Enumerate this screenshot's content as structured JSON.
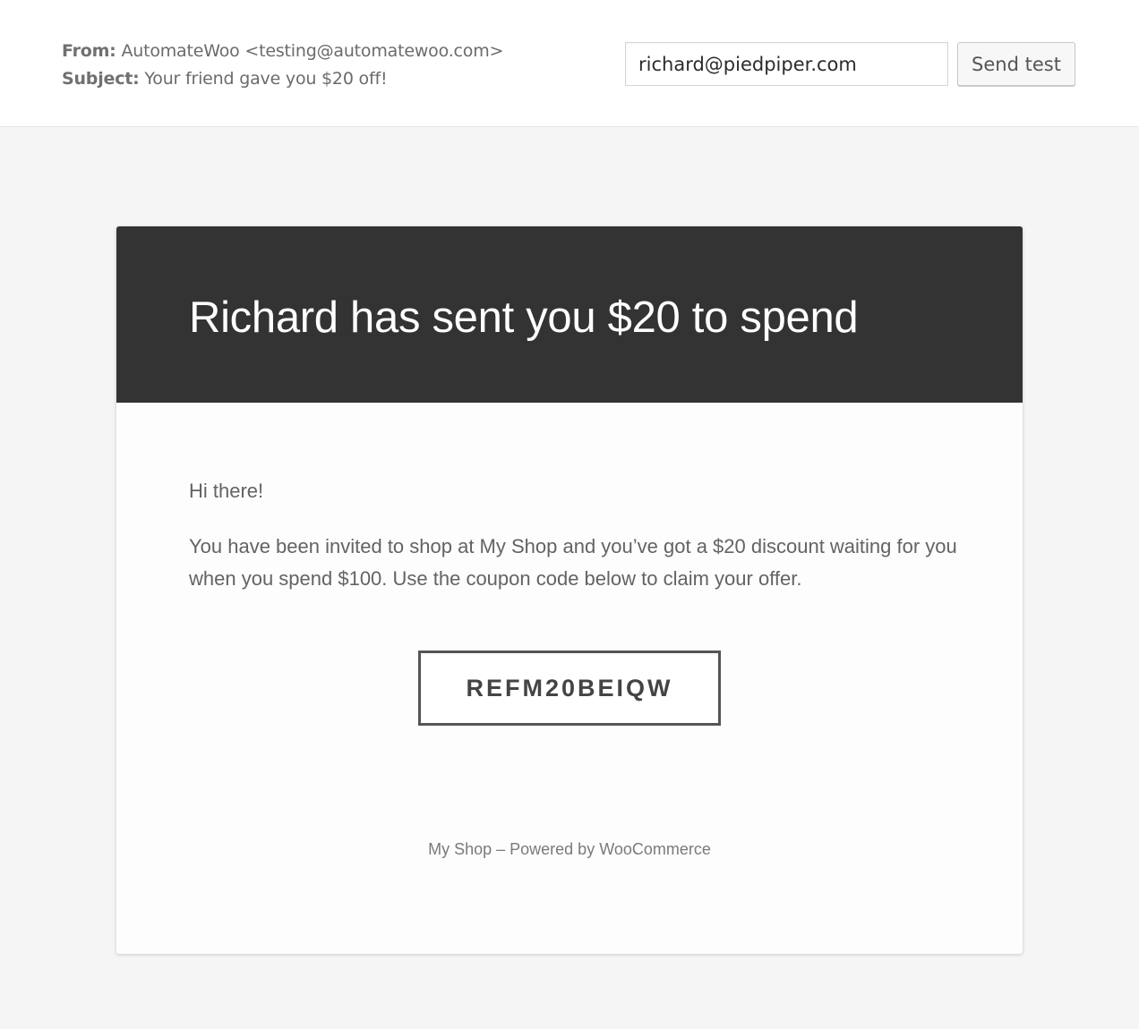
{
  "header": {
    "from_label": "From:",
    "from_value": "AutomateWoo <testing@automatewoo.com>",
    "subject_label": "Subject:",
    "subject_value": "Your friend gave you $20 off!"
  },
  "send_test": {
    "email_value": "richard@piedpiper.com",
    "button_label": "Send test"
  },
  "email": {
    "title": "Richard has sent you $20 to spend",
    "greeting": "Hi there!",
    "body": "You have been invited to shop at My Shop and you’ve got a $20 discount waiting for you when you spend $100. Use the coupon code below to claim your offer.",
    "coupon_code": "REFM20BEIQW",
    "footer": "My Shop – Powered by WooCommerce"
  },
  "colors": {
    "header_bg": "#333333",
    "page_bg": "#f5f5f5",
    "card_bg": "#fdfdfd"
  }
}
